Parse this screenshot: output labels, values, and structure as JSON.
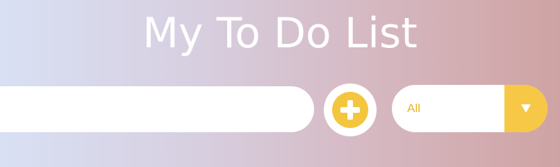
{
  "app": {
    "title": "My To Do List"
  },
  "form": {
    "todo_input_value": "",
    "add_button_icon": "plus-icon",
    "filter": {
      "selected": "All",
      "icon": "caret-down-icon"
    }
  },
  "colors": {
    "accent": "#f4c63f",
    "filter_text": "#e7b622",
    "title_text": "#ffffff"
  }
}
